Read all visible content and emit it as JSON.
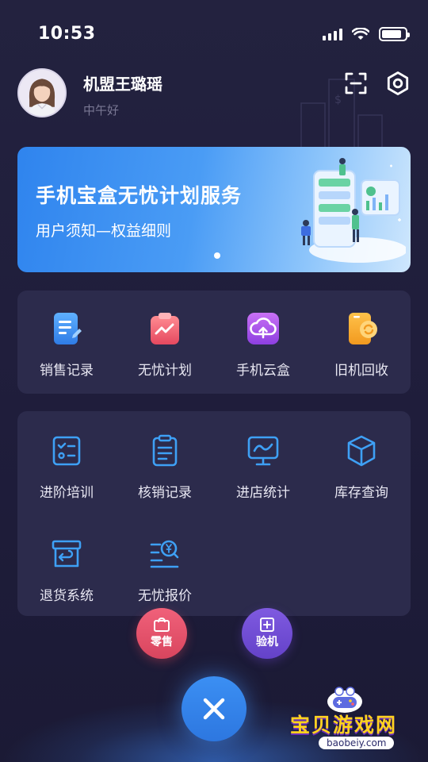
{
  "status_bar": {
    "time": "10:53",
    "battery_level": 0.85
  },
  "profile": {
    "name": "机盟王璐瑶",
    "greeting": "中午好"
  },
  "banner": {
    "title": "手机宝盒无忧计划服务",
    "subtitle": "用户须知—权益细则",
    "page_index": 1,
    "page_count": 1
  },
  "quick_menu": [
    {
      "label": "销售记录",
      "icon": "document-icon"
    },
    {
      "label": "无忧计划",
      "icon": "clipboard-chart-icon"
    },
    {
      "label": "手机云盒",
      "icon": "cloud-upload-icon"
    },
    {
      "label": "旧机回收",
      "icon": "phone-recycle-icon"
    }
  ],
  "tools_menu": [
    {
      "label": "进阶培训",
      "icon": "checklist-icon"
    },
    {
      "label": "核销记录",
      "icon": "clipboard-list-icon"
    },
    {
      "label": "进店统计",
      "icon": "monitor-chart-icon"
    },
    {
      "label": "库存查询",
      "icon": "box-icon"
    },
    {
      "label": "退货系统",
      "icon": "return-box-icon"
    },
    {
      "label": "无忧报价",
      "icon": "price-search-icon"
    }
  ],
  "actions": {
    "retail_label": "零售",
    "check_label": "验机"
  },
  "watermark": {
    "brand": "宝贝游戏网",
    "url": "baobeiy.com"
  },
  "colors": {
    "background": "#23223f",
    "card": "#2c2b4c",
    "accent_blue": "#3a8cf2",
    "retail_red": "#e4526b",
    "check_purple": "#7150d6"
  }
}
